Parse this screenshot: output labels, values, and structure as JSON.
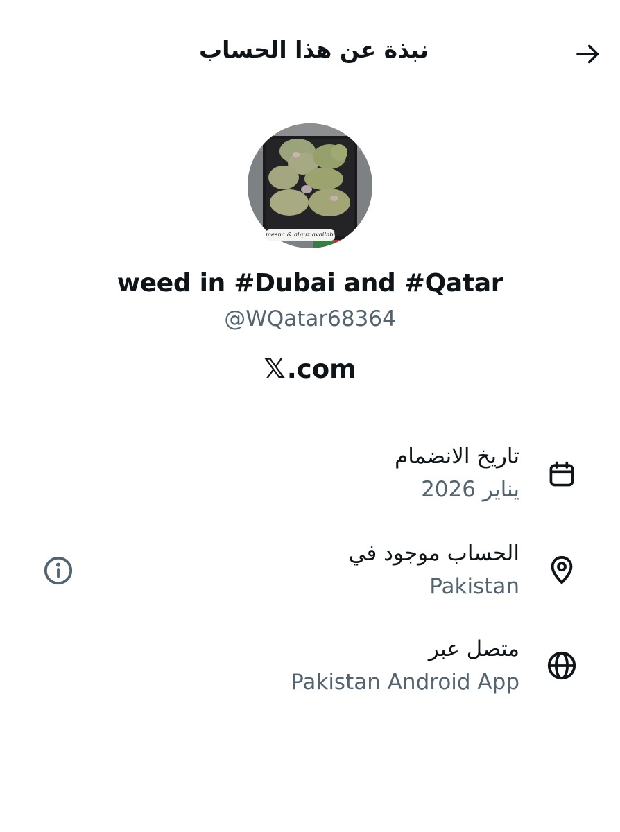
{
  "header": {
    "title": "نبذة عن هذا الحساب",
    "back_icon": "arrow-right-icon"
  },
  "profile": {
    "avatar_caption": "mesha & alquz available",
    "display_name": "weed in #Dubai and #Qatar",
    "handle": "@WQatar68364",
    "brand_glyph": "𝕏",
    "brand_suffix": ".com"
  },
  "details": [
    {
      "icon": "calendar-icon",
      "label": "تاريخ الانضمام",
      "value": "يناير 2026"
    },
    {
      "icon": "location-pin-icon",
      "label": "الحساب موجود في",
      "value": "Pakistan"
    },
    {
      "icon": "globe-icon",
      "label": "متصل عبر",
      "value": "Pakistan Android App"
    }
  ],
  "info_icon": "info-icon"
}
